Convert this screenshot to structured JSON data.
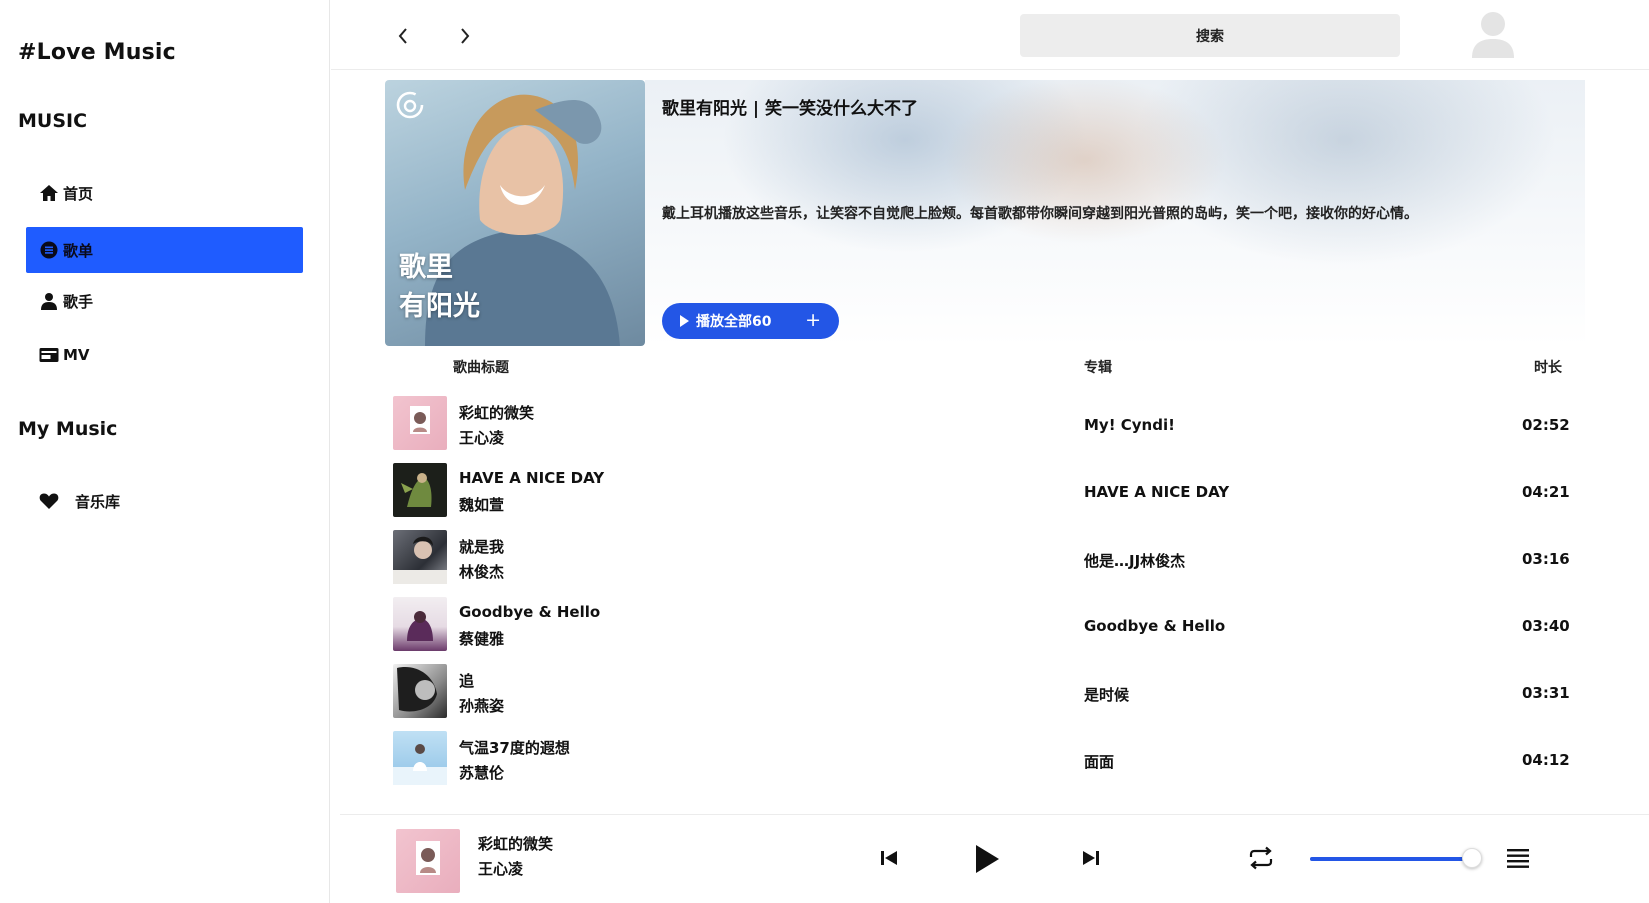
{
  "app": {
    "brand": "#Love Music"
  },
  "sidebar": {
    "sections": [
      {
        "title": "MUSIC"
      },
      {
        "title": "My Music"
      }
    ],
    "items": [
      {
        "label": "首页",
        "icon": "home-icon"
      },
      {
        "label": "歌单",
        "icon": "playlist-icon",
        "active": true
      },
      {
        "label": "歌手",
        "icon": "user-icon"
      },
      {
        "label": "MV",
        "icon": "video-icon"
      },
      {
        "label": "音乐库",
        "icon": "heart-icon"
      }
    ],
    "active_color": "#1f5cff"
  },
  "header": {
    "search_label": "搜索"
  },
  "playlist": {
    "title": "歌里有阳光 | 笑一笑没什么大不了",
    "cover_text_line1": "歌里",
    "cover_text_line2": "有阳光",
    "description": "戴上耳机播放这些音乐，让笑容不自觉爬上脸颊。每首歌都带你瞬间穿越到阳光普照的岛屿，笑一个吧，接收你的好心情。",
    "play_all_label": "播放全部60",
    "add_label": "+",
    "accent_color": "#2356e6"
  },
  "table": {
    "headers": {
      "title": "歌曲标题",
      "album": "专辑",
      "duration": "时长"
    },
    "tracks": [
      {
        "name": "彩虹的微笑",
        "artist": "王心凌",
        "album": "My! Cyndi!",
        "duration": "02:52"
      },
      {
        "name": "HAVE A NICE DAY",
        "artist": "魏如萱",
        "album": "HAVE A NICE DAY",
        "duration": "04:21"
      },
      {
        "name": "就是我",
        "artist": "林俊杰",
        "album": "他是…JJ林俊杰",
        "duration": "03:16"
      },
      {
        "name": "Goodbye & Hello",
        "artist": "蔡健雅",
        "album": "Goodbye & Hello",
        "duration": "03:40"
      },
      {
        "name": "追",
        "artist": "孙燕姿",
        "album": "是时候",
        "duration": "03:31"
      },
      {
        "name": "气温37度的遐想",
        "artist": "苏慧伦",
        "album": "面面",
        "duration": "04:12"
      }
    ]
  },
  "player": {
    "current_name": "彩虹的微笑",
    "current_artist": "王心凌",
    "volume_fraction": 0.95
  }
}
